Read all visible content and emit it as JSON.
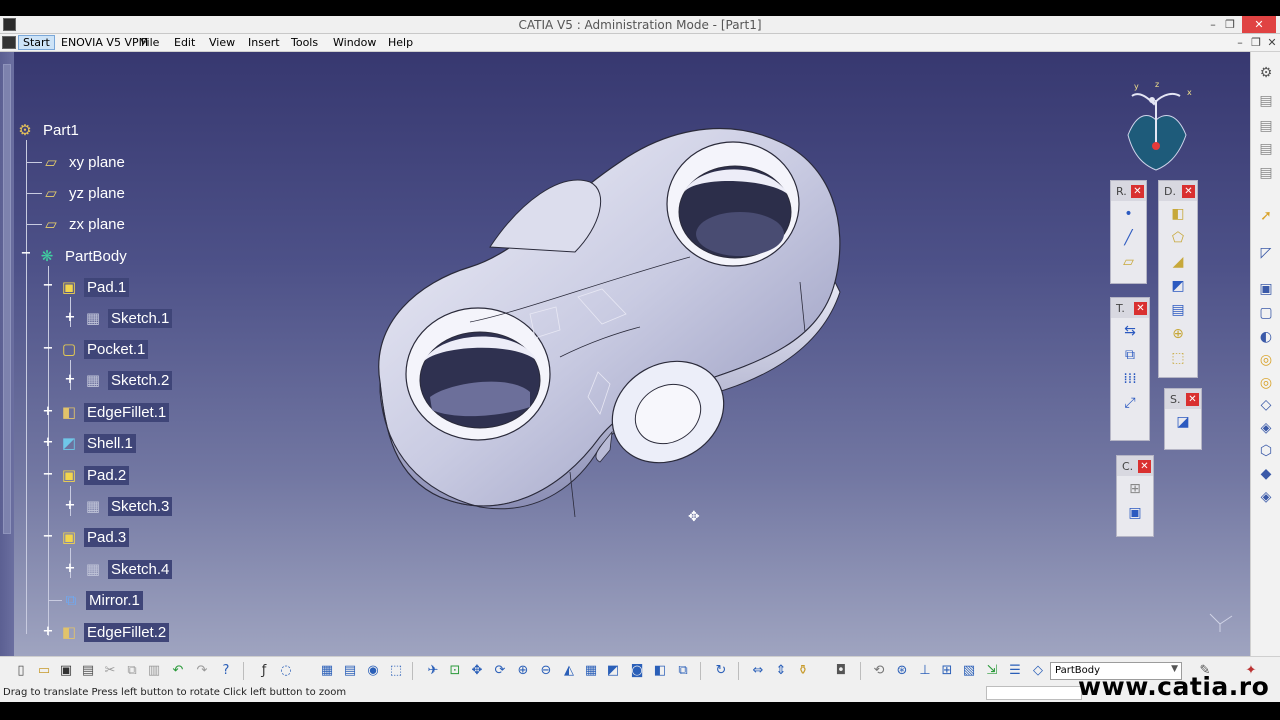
{
  "window": {
    "title": "CATIA V5 : Administration Mode - [Part1]",
    "min_label": "–",
    "max_label": "❐",
    "close_label": "✕"
  },
  "menu": {
    "items": [
      "Start",
      "ENOVIA V5 VPM",
      "File",
      "Edit",
      "View",
      "Insert",
      "Tools",
      "Window",
      "Help"
    ]
  },
  "tree": {
    "nodes": [
      {
        "label": "Part1",
        "icon": "gear-part-icon"
      },
      {
        "label": "xy plane",
        "icon": "plane-icon"
      },
      {
        "label": "yz plane",
        "icon": "plane-icon"
      },
      {
        "label": "zx plane",
        "icon": "plane-icon"
      },
      {
        "label": "PartBody",
        "icon": "body-gear-icon"
      },
      {
        "label": "Pad.1",
        "icon": "pad-icon"
      },
      {
        "label": "Sketch.1",
        "icon": "sketch-icon"
      },
      {
        "label": "Pocket.1",
        "icon": "pocket-icon"
      },
      {
        "label": "Sketch.2",
        "icon": "sketch-icon"
      },
      {
        "label": "EdgeFillet.1",
        "icon": "fillet-icon"
      },
      {
        "label": "Shell.1",
        "icon": "shell-icon"
      },
      {
        "label": "Pad.2",
        "icon": "pad-icon"
      },
      {
        "label": "Sketch.3",
        "icon": "sketch-icon"
      },
      {
        "label": "Pad.3",
        "icon": "pad-icon"
      },
      {
        "label": "Sketch.4",
        "icon": "sketch-icon"
      },
      {
        "label": "Mirror.1",
        "icon": "mirror-icon"
      },
      {
        "label": "EdgeFillet.2",
        "icon": "fillet-icon"
      }
    ]
  },
  "palettes": {
    "r": {
      "title": "R."
    },
    "d": {
      "title": "D."
    },
    "t": {
      "title": "T."
    },
    "s": {
      "title": "S."
    },
    "c": {
      "title": "C."
    }
  },
  "compass": {
    "x": "x",
    "y": "y",
    "z": "z"
  },
  "bottom_toolbar": {
    "current_body": "PartBody"
  },
  "status": {
    "message": "Drag to translate  Press left button to rotate  Click left button to zoom"
  },
  "watermark": "www.catia.ro"
}
